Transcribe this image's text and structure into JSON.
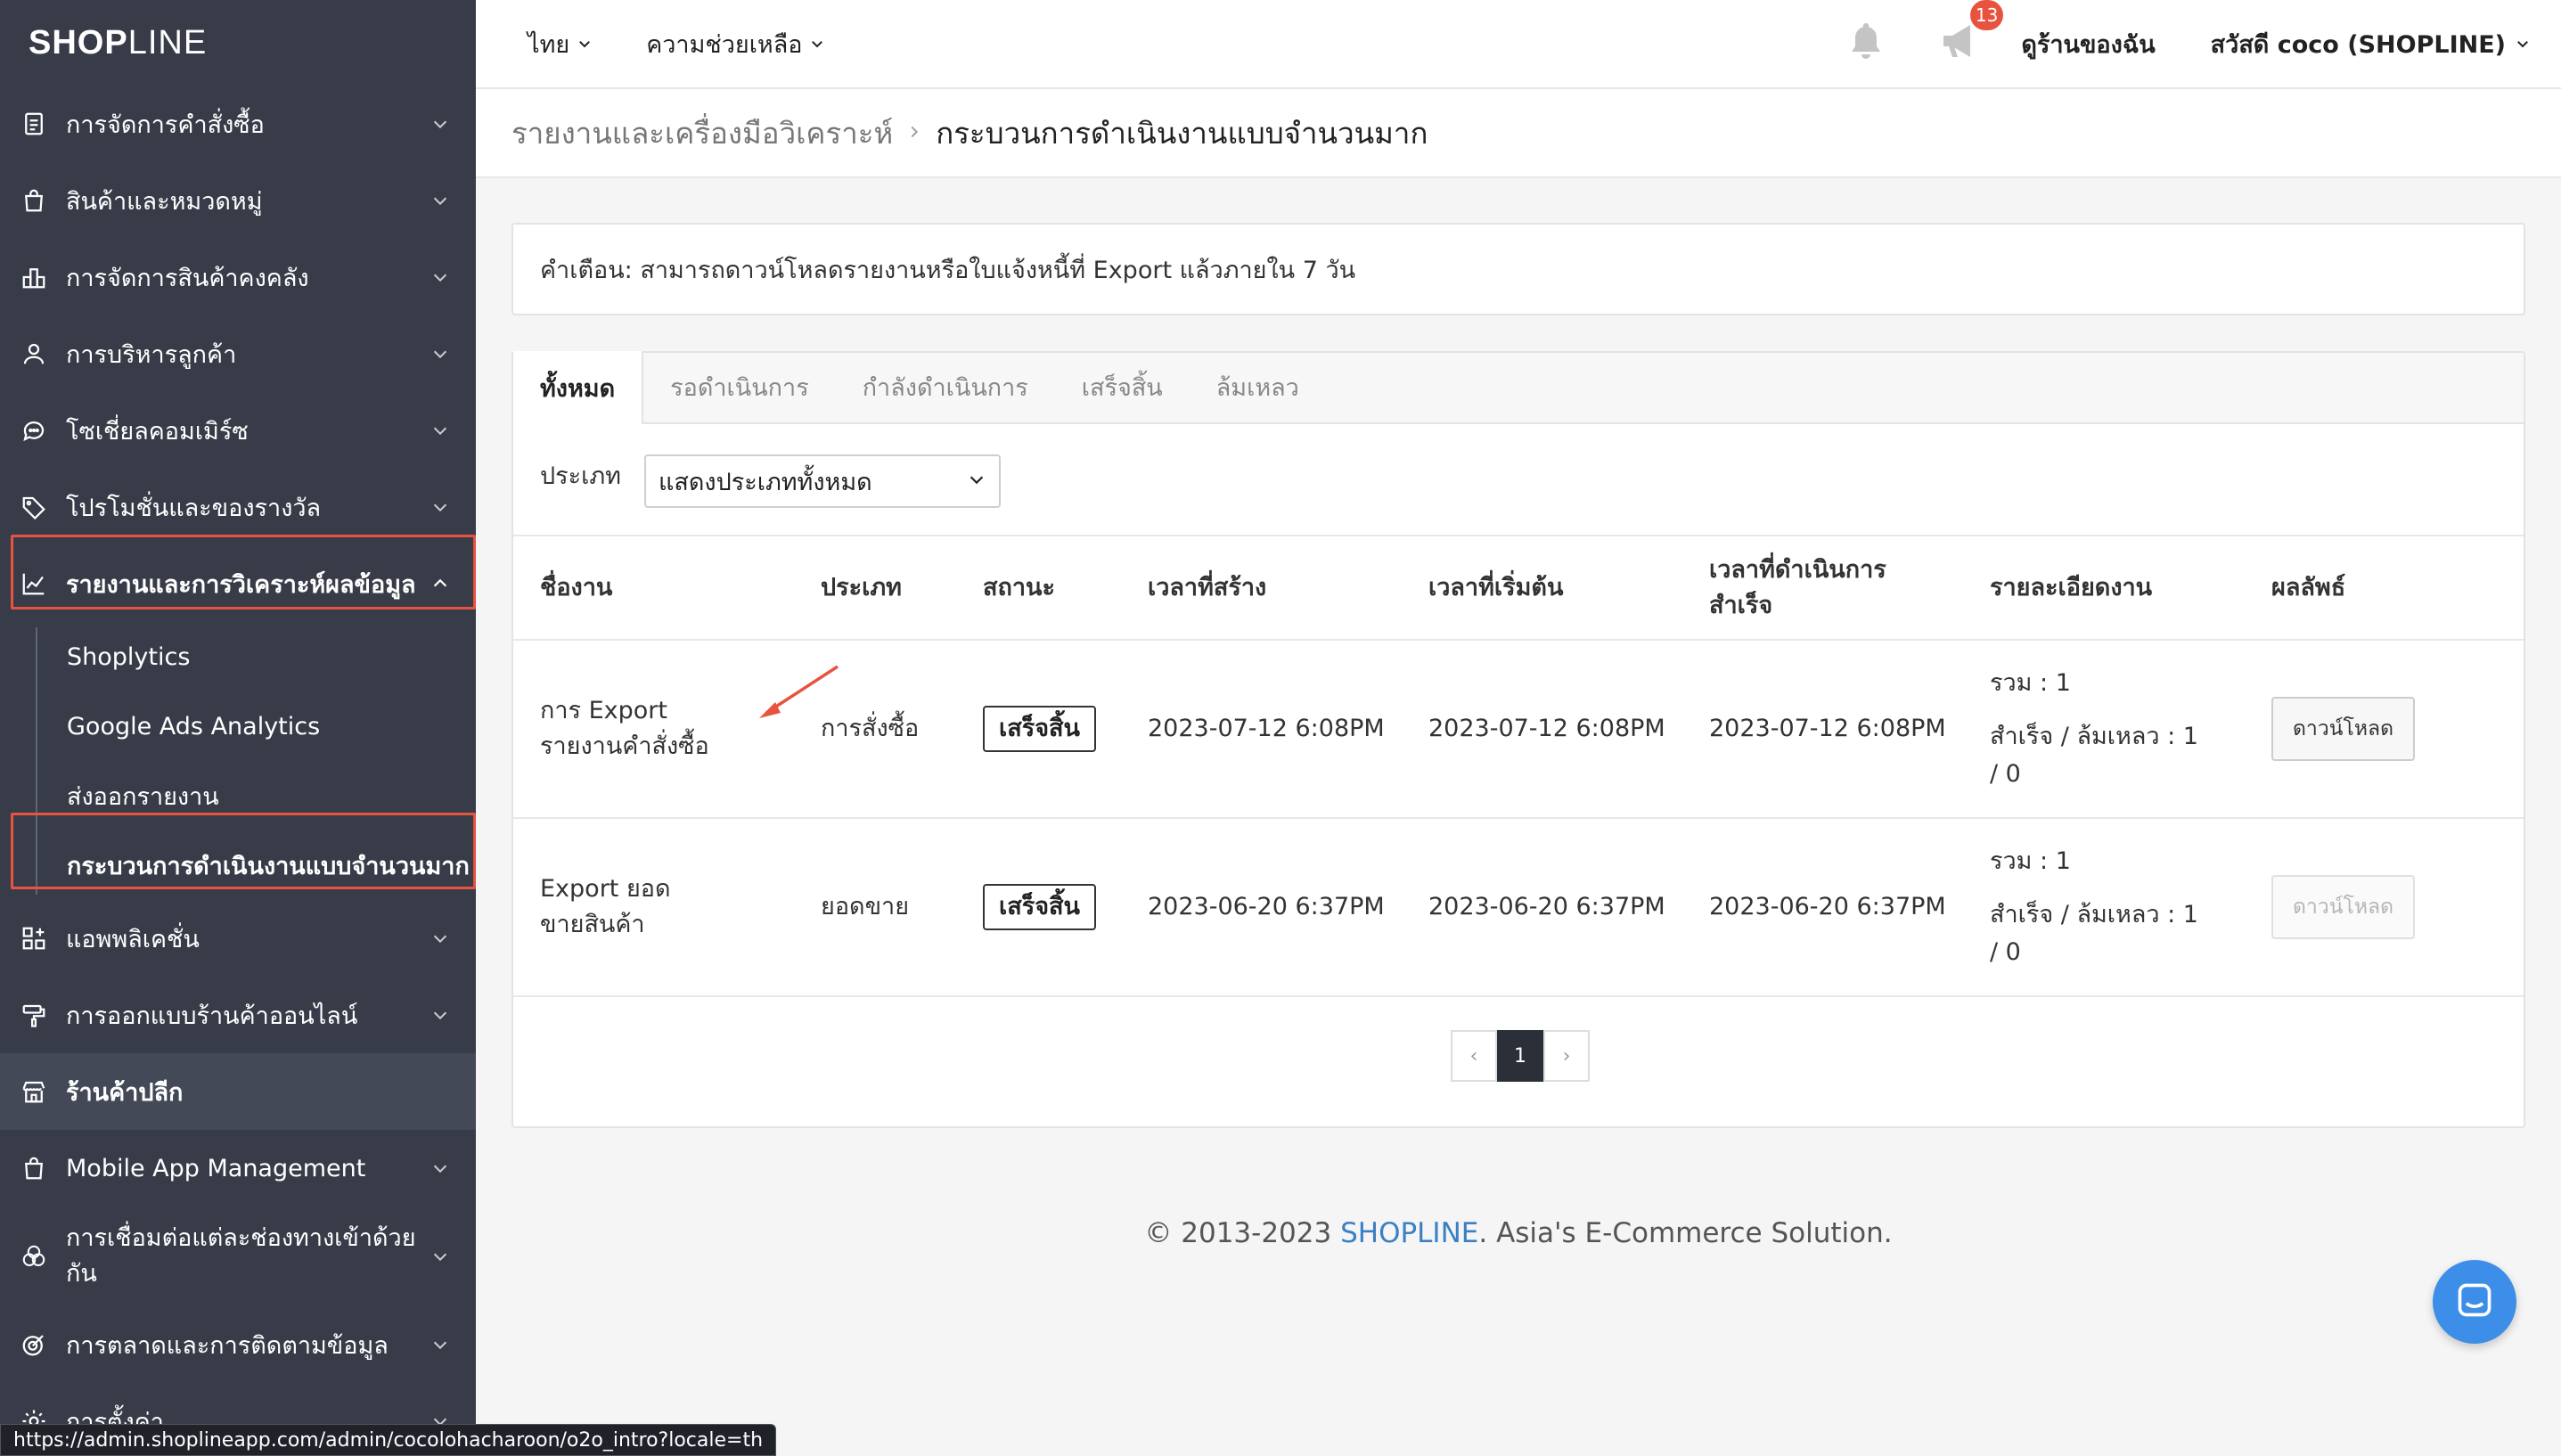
{
  "brand": {
    "logo_bold": "SHOP",
    "logo_thin": "LINE"
  },
  "sidebar": {
    "items": [
      {
        "label": "การจัดการคำสั่งซื้อ",
        "icon": "clipboard-icon"
      },
      {
        "label": "สินค้าและหมวดหมู่",
        "icon": "shopping-bag-icon"
      },
      {
        "label": "การจัดการสินค้าคงคลัง",
        "icon": "warehouse-icon"
      },
      {
        "label": "การบริหารลูกค้า",
        "icon": "user-icon"
      },
      {
        "label": "โซเชี่ยลคอมเมิร์ซ",
        "icon": "chat-bubble-icon"
      },
      {
        "label": "โปรโมชั่นและของรางวัล",
        "icon": "tag-icon"
      },
      {
        "label": "รายงานและการวิเคราะห์ผลข้อมูล",
        "icon": "bar-chart-icon"
      }
    ],
    "sub_items": [
      {
        "label": "Shoplytics"
      },
      {
        "label": "Google Ads Analytics"
      },
      {
        "label": "ส่งออกรายงาน"
      },
      {
        "label": "กระบวนการดำเนินงานแบบจำนวนมาก"
      }
    ],
    "items_after": [
      {
        "label": "แอพพลิเคชั่น",
        "icon": "apps-grid-icon"
      },
      {
        "label": "การออกแบบร้านค้าออนไลน์",
        "icon": "paint-roller-icon"
      },
      {
        "label": "ร้านค้าปลีก",
        "icon": "storefront-icon"
      },
      {
        "label": "Mobile App Management",
        "icon": "mobile-bag-icon"
      },
      {
        "label": "การเชื่อมต่อแต่ละช่องทางเข้าด้วยกัน",
        "icon": "circles-icon"
      },
      {
        "label": "การตลาดและการติดตามข้อมูล",
        "icon": "target-icon"
      },
      {
        "label": "การตั้งค่า",
        "icon": "gear-icon"
      }
    ]
  },
  "topbar": {
    "language": "ไทย",
    "help": "ความช่วยเหลือ",
    "announcement_count": "13",
    "my_store": "ดูร้านของฉัน",
    "greeting": "สวัสดี coco (SHOPLINE)"
  },
  "breadcrumb": {
    "parent": "รายงานและเครื่องมือวิเคราะห์",
    "current": "กระบวนการดำเนินงานแบบจำนวนมาก"
  },
  "notice": "คำเตือน: สามารถดาวน์โหลดรายงานหรือใบแจ้งหนี้ที่ Export แล้วภายใน 7 วัน",
  "tabs": [
    "ทั้งหมด",
    "รอดำเนินการ",
    "กำลังดำเนินการ",
    "เสร็จสิ้น",
    "ล้มเหลว"
  ],
  "filter": {
    "label": "ประเภท",
    "value": "แสดงประเภททั้งหมด"
  },
  "table": {
    "headers": [
      "ชื่องาน",
      "ประเภท",
      "สถานะ",
      "เวลาที่สร้าง",
      "เวลาที่เริ่มต้น",
      "เวลาที่ดำเนินการสำเร็จ",
      "รายละเอียดงาน",
      "ผลลัพธ์"
    ],
    "rows": [
      {
        "name": "การ Export รายงานคำสั่งซื้อ",
        "type": "การสั่งซื้อ",
        "status": "เสร็จสิ้น",
        "created": "2023-07-12 6:08PM",
        "started": "2023-07-12 6:08PM",
        "completed": "2023-07-12 6:08PM",
        "total": "รวม : 1",
        "success_fail": "สำเร็จ / ล้มเหลว : 1 / 0",
        "action": "ดาวน์โหลด"
      },
      {
        "name": "Export ยอดขายสินค้า",
        "type": "ยอดขาย",
        "status": "เสร็จสิ้น",
        "created": "2023-06-20 6:37PM",
        "started": "2023-06-20 6:37PM",
        "completed": "2023-06-20 6:37PM",
        "total": "รวม : 1",
        "success_fail": "สำเร็จ / ล้มเหลว : 1 / 0",
        "action": "ดาวน์โหลด"
      }
    ]
  },
  "pagination": {
    "prev": "‹",
    "current": "1",
    "next": "›"
  },
  "footer": {
    "prefix": "© 2013-2023 ",
    "link": "SHOPLINE",
    "suffix": ". Asia's E-Commerce Solution."
  },
  "status_url": "https://admin.shoplineapp.com/admin/cocolohacharoon/o2o_intro?locale=th",
  "colors": {
    "sidebar_bg": "#373c48",
    "highlight": "#e8533f",
    "link": "#3b7fc4",
    "chat": "#3c8ee8"
  }
}
